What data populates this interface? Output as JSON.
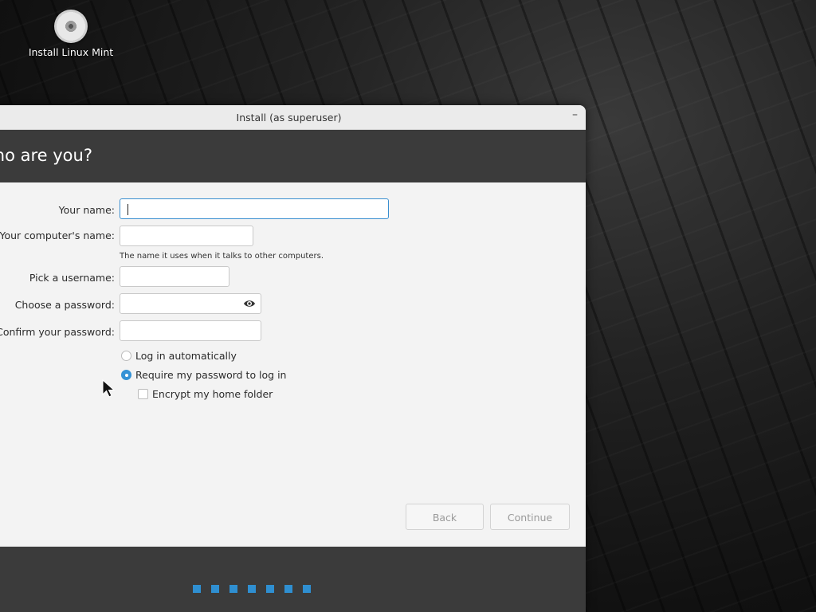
{
  "desktop": {
    "icon_label": "Install Linux Mint"
  },
  "window": {
    "title": "Install (as superuser)",
    "minimize_label": "–"
  },
  "header": {
    "title": "Who are you?"
  },
  "form": {
    "name_label": "Your name:",
    "name_value": "",
    "computer_label": "Your computer's name:",
    "computer_value": "",
    "computer_hint": "The name it uses when it talks to other computers.",
    "username_label": "Pick a username:",
    "username_value": "",
    "password_label": "Choose a password:",
    "password_value": "",
    "confirm_label": "Confirm your password:",
    "confirm_value": "",
    "login_auto_label": "Log in automatically",
    "require_password_label": "Require my password to log in",
    "encrypt_label": "Encrypt my home folder",
    "login_auto_selected": false,
    "require_password_selected": true,
    "encrypt_checked": false
  },
  "buttons": {
    "back_label": "Back",
    "continue_label": "Continue"
  },
  "progress": {
    "steps_completed": 7
  },
  "colors": {
    "accent": "#3592d6",
    "header_bg": "#3b3b3b"
  }
}
